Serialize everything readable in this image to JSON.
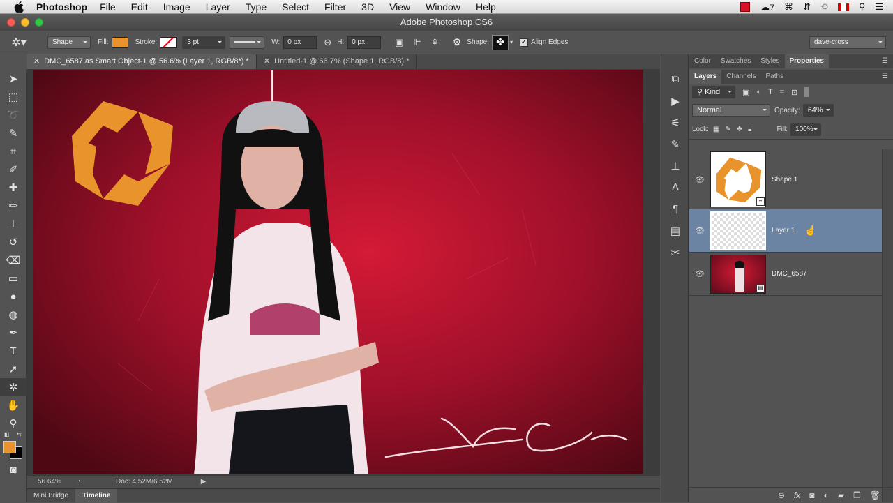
{
  "menubar": {
    "app": "Photoshop",
    "items": [
      "File",
      "Edit",
      "Image",
      "Layer",
      "Type",
      "Select",
      "Filter",
      "3D",
      "View",
      "Window",
      "Help"
    ],
    "cc_badge": "7"
  },
  "window": {
    "title": "Adobe Photoshop CS6"
  },
  "options": {
    "mode": "Shape",
    "fill_label": "Fill:",
    "fill_color": "#e8932b",
    "stroke_label": "Stroke:",
    "stroke_width": "3 pt",
    "w_label": "W:",
    "w_value": "0 px",
    "h_label": "H:",
    "h_value": "0 px",
    "shape_label": "Shape:",
    "align_edges": "Align Edges",
    "workspace": "dave-cross"
  },
  "tabs": [
    {
      "label": "DMC_6587 as Smart Object-1 @ 56.6% (Layer 1, RGB/8*) *"
    },
    {
      "label": "Untitled-1 @ 66.7% (Shape 1, RGB/8) *"
    }
  ],
  "status": {
    "zoom": "56.64%",
    "doc": "Doc: 4.52M/6.52M"
  },
  "bottom_tabs": [
    "Mini Bridge",
    "Timeline"
  ],
  "panel_tabs_top": [
    "Color",
    "Swatches",
    "Styles",
    "Properties"
  ],
  "panel_tabs_layers": [
    "Layers",
    "Channels",
    "Paths"
  ],
  "layers_panel": {
    "filter": "Kind",
    "blend_mode": "Normal",
    "opacity_label": "Opacity:",
    "opacity": "64%",
    "lock_label": "Lock:",
    "fill_label": "Fill:",
    "fill": "100%",
    "layers": [
      {
        "name": "Shape 1"
      },
      {
        "name": "Layer 1"
      },
      {
        "name": "DMC_6587"
      }
    ]
  },
  "photo": {
    "logo_color": "#e8932b",
    "signature": "Dave Cross"
  },
  "colors": {
    "accent": "#6b84a3",
    "foreground": "#e8932b",
    "background": "#000000"
  }
}
